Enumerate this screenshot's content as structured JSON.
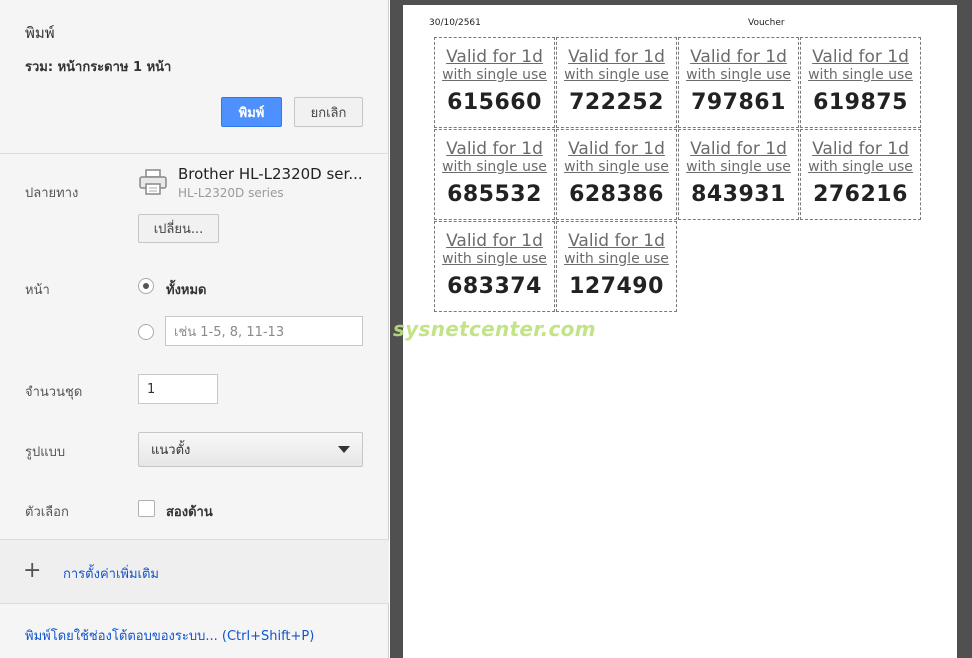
{
  "dialog": {
    "title": "พิมพ์",
    "summary": "รวม: หน้ากระดาษ 1 หน้า",
    "print_label": "พิมพ์",
    "cancel_label": "ยกเลิก"
  },
  "destination": {
    "label": "ปลายทาง",
    "printer_name": "Brother HL-L2320D ser...",
    "printer_model": "HL-L2320D series",
    "change_label": "เปลี่ยน..."
  },
  "pages": {
    "label": "หน้า",
    "all_label": "ทั้งหมด",
    "custom_placeholder": "เช่น 1-5, 8, 11-13",
    "selected": "all"
  },
  "copies": {
    "label": "จำนวนชุด",
    "value": "1"
  },
  "layout": {
    "label": "รูปแบบ",
    "value": "แนวตั้ง"
  },
  "options": {
    "label": "ตัวเลือก",
    "two_sided_label": "สองด้าน",
    "two_sided_checked": false
  },
  "more_settings_label": "การตั้งค่าเพิ่มเติม",
  "system_dialog_link": "พิมพ์โดยใช้ช่องโต้ตอบของระบบ... (Ctrl+Shift+P)",
  "preview": {
    "date": "30/10/2561",
    "title": "Voucher",
    "vouchers": [
      {
        "line1": "Valid for 1d",
        "line2": "with single use",
        "code": "615660"
      },
      {
        "line1": "Valid for 1d",
        "line2": "with single use",
        "code": "722252"
      },
      {
        "line1": "Valid for 1d",
        "line2": "with single use",
        "code": "797861"
      },
      {
        "line1": "Valid for 1d",
        "line2": "with single use",
        "code": "619875"
      },
      {
        "line1": "Valid for 1d",
        "line2": "with single use",
        "code": "685532"
      },
      {
        "line1": "Valid for 1d",
        "line2": "with single use",
        "code": "628386"
      },
      {
        "line1": "Valid for 1d",
        "line2": "with single use",
        "code": "843931"
      },
      {
        "line1": "Valid for 1d",
        "line2": "with single use",
        "code": "276216"
      },
      {
        "line1": "Valid for 1d",
        "line2": "with single use",
        "code": "683374"
      },
      {
        "line1": "Valid for 1d",
        "line2": "with single use",
        "code": "127490"
      }
    ]
  },
  "watermark": "sysnetcenter.com",
  "icons": {
    "printer": "printer-icon",
    "plus": "plus-icon",
    "caret": "chevron-down-icon"
  },
  "colors": {
    "primary_button": "#4d90fe",
    "link": "#1155cc",
    "watermark": "#bde27a",
    "preview_background": "#505050"
  }
}
